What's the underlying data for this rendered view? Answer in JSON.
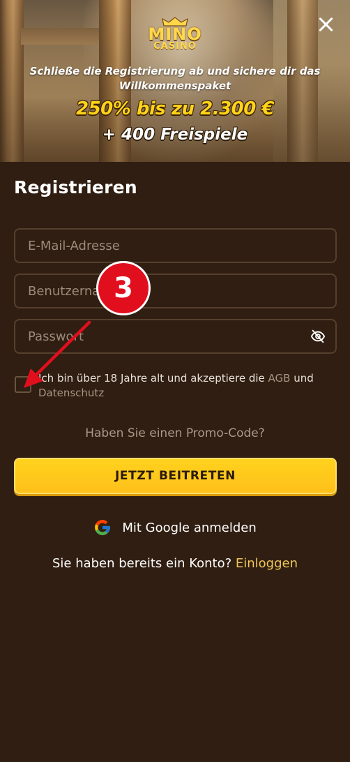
{
  "hero": {
    "logo_top": "MINO",
    "logo_bottom": "CASINO",
    "subtitle_line1": "Schließe die Registrierung ab und sichere dir das",
    "subtitle_line2": "Willkommenspaket",
    "bonus": "250% bis zu 2.300 €",
    "spins": "+ 400 Freispiele"
  },
  "form": {
    "title": "Registrieren",
    "email_placeholder": "E-Mail-Adresse",
    "username_placeholder": "Benutzername",
    "password_placeholder": "Passwort",
    "terms_prefix": "Ich bin über 18 Jahre alt und akzeptiere die ",
    "terms_agb": "AGB",
    "terms_and": " und ",
    "terms_privacy": "Datenschutz",
    "promo": "Haben Sie einen Promo-Code?",
    "submit_label": "JETZT BEITRETEN",
    "google_label": "Mit Google anmelden",
    "login_prompt": "Sie haben bereits ein Konto? ",
    "login_link": "Einloggen"
  },
  "annotation": {
    "step_number": "3"
  },
  "colors": {
    "background": "#2f1e11",
    "accent_yellow": "#ffc81e",
    "link_gold": "#f0c65a",
    "badge_red": "#e10f1e"
  },
  "icons": [
    "close-icon",
    "eye-off-icon",
    "google-icon",
    "crown-icon"
  ]
}
